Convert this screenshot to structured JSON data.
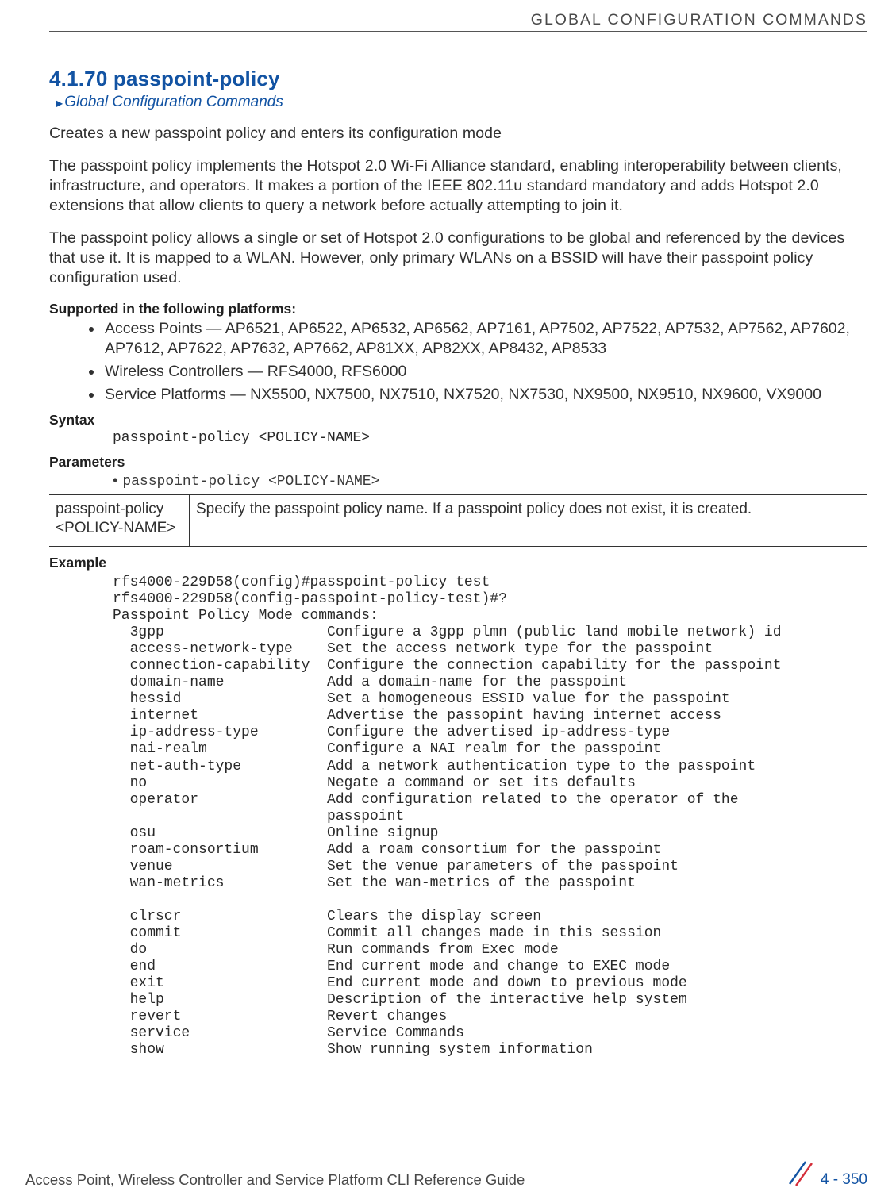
{
  "header": {
    "running_title": "GLOBAL CONFIGURATION COMMANDS"
  },
  "section": {
    "number_title": "4.1.70 passpoint-policy",
    "breadcrumb": "Global Configuration Commands"
  },
  "paragraphs": {
    "intro": "Creates a new passpoint policy and enters its configuration mode",
    "p2": "The passpoint policy implements the Hotspot 2.0 Wi-Fi Alliance standard, enabling interoperability between clients, infrastructure, and operators. It makes a portion of the IEEE 802.11u standard mandatory and adds Hotspot 2.0 extensions that allow clients to query a network before actually attempting to join it.",
    "p3": "The passpoint policy allows a single or set of Hotspot 2.0 configurations to be global and referenced by the devices that use it. It is mapped to a WLAN. However, only primary WLANs on a BSSID will have their passpoint policy configuration used."
  },
  "supported": {
    "heading": "Supported in the following platforms:",
    "items": [
      "Access Points — AP6521, AP6522, AP6532, AP6562, AP7161, AP7502, AP7522, AP7532, AP7562, AP7602, AP7612, AP7622, AP7632, AP7662, AP81XX, AP82XX, AP8432, AP8533",
      "Wireless Controllers — RFS4000, RFS6000",
      "Service Platforms — NX5500, NX7500, NX7510, NX7520, NX7530, NX9500, NX9510, NX9600, VX9000"
    ]
  },
  "syntax": {
    "heading": "Syntax",
    "line": "passpoint-policy <POLICY-NAME>"
  },
  "parameters": {
    "heading": "Parameters",
    "bullet": "passpoint-policy <POLICY-NAME>",
    "row_key": "passpoint-policy <POLICY-NAME>",
    "row_desc": "Specify the passpoint policy name. If a passpoint policy does not exist, it is created."
  },
  "example": {
    "heading": "Example",
    "text": "rfs4000-229D58(config)#passpoint-policy test\nrfs4000-229D58(config-passpoint-policy-test)#?\nPasspoint Policy Mode commands:\n  3gpp                   Configure a 3gpp plmn (public land mobile network) id\n  access-network-type    Set the access network type for the passpoint\n  connection-capability  Configure the connection capability for the passpoint\n  domain-name            Add a domain-name for the passpoint\n  hessid                 Set a homogeneous ESSID value for the passpoint\n  internet               Advertise the passopint having internet access\n  ip-address-type        Configure the advertised ip-address-type\n  nai-realm              Configure a NAI realm for the passpoint\n  net-auth-type          Add a network authentication type to the passpoint\n  no                     Negate a command or set its defaults\n  operator               Add configuration related to the operator of the\n                         passpoint\n  osu                    Online signup\n  roam-consortium        Add a roam consortium for the passpoint\n  venue                  Set the venue parameters of the passpoint\n  wan-metrics            Set the wan-metrics of the passpoint\n\n  clrscr                 Clears the display screen\n  commit                 Commit all changes made in this session\n  do                     Run commands from Exec mode\n  end                    End current mode and change to EXEC mode\n  exit                   End current mode and down to previous mode\n  help                   Description of the interactive help system\n  revert                 Revert changes\n  service                Service Commands\n  show                   Show running system information"
  },
  "footer": {
    "left": "Access Point, Wireless Controller and Service Platform CLI Reference Guide",
    "page": "4 - 350"
  }
}
